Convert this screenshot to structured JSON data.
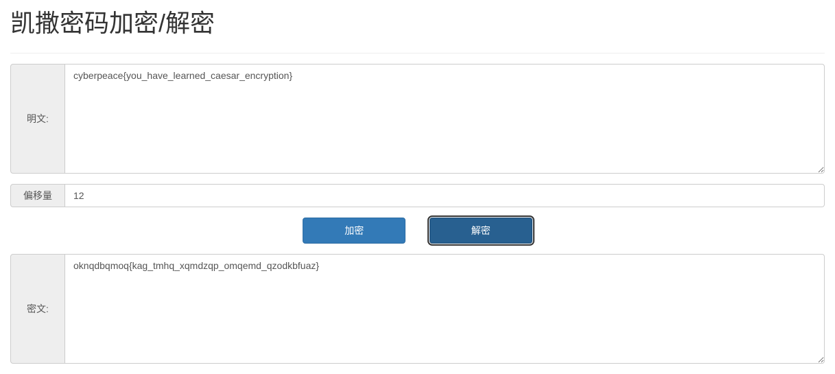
{
  "title": "凯撒密码加密/解密",
  "plaintext": {
    "label": "明文:",
    "value": "cyberpeace{you_have_learned_caesar_encryption}"
  },
  "offset": {
    "label": "偏移量",
    "value": "12"
  },
  "buttons": {
    "encrypt": "加密",
    "decrypt": "解密"
  },
  "ciphertext": {
    "label": "密文:",
    "value": "oknqdbqmoq{kag_tmhq_xqmdzqp_omqemd_qzodkbfuaz}"
  }
}
